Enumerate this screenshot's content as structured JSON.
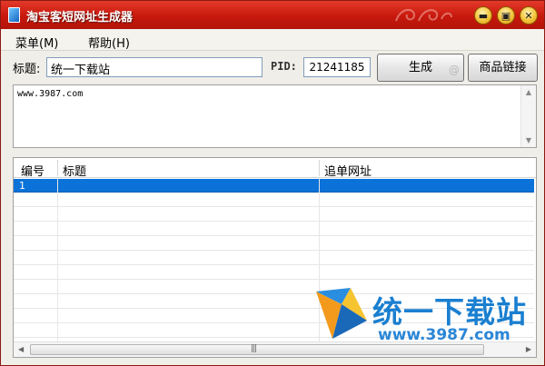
{
  "window": {
    "title": "淘宝客短网址生成器",
    "controls": {
      "minimize_icon": "minimize-icon",
      "maximize_icon": "maximize-icon",
      "close_icon": "close-icon"
    }
  },
  "menubar": {
    "items": [
      {
        "label": "菜单(M)"
      },
      {
        "label": "帮助(H)"
      }
    ]
  },
  "form": {
    "title_label": "标题:",
    "title_value": "统一下载站",
    "pid_label": "PID:",
    "pid_value": "21241185",
    "generate_button": "生成",
    "product_link_button": "商品链接"
  },
  "textarea": {
    "content": "www.3987.com"
  },
  "table": {
    "columns": [
      "编号",
      "标题",
      "追单网址"
    ],
    "rows": [
      {
        "id": "1",
        "title": "",
        "url": "",
        "selected": true
      }
    ]
  },
  "watermark": {
    "brand": "统一下载站",
    "url": "www.3987.com"
  },
  "colors": {
    "titlebar": "#c8180d",
    "selection": "#0a72d8",
    "watermark": "#1a7fd0"
  }
}
